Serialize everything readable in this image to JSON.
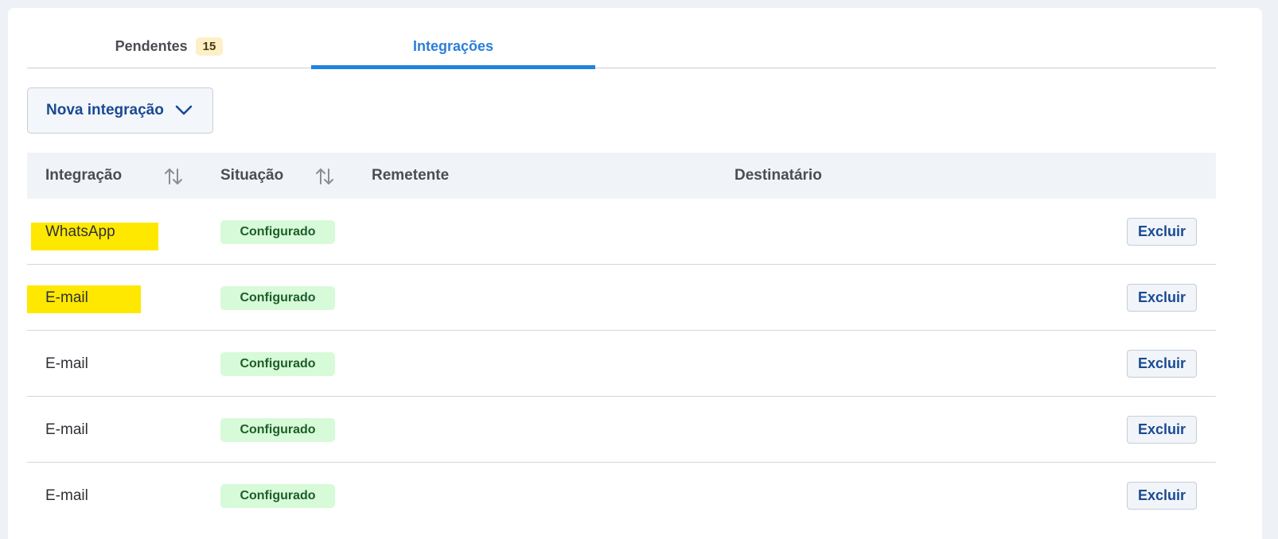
{
  "tabs": [
    {
      "label": "Pendentes",
      "count": "15"
    },
    {
      "label": "Integrações"
    }
  ],
  "new_button": {
    "label": "Nova integração",
    "icon": "chevron-down-icon"
  },
  "table": {
    "headers": {
      "integration": "Integração",
      "status": "Situação",
      "sender": "Remetente",
      "recipient": "Destinatário"
    },
    "rows": [
      {
        "name": "WhatsApp",
        "status": "Configurado",
        "action": "Excluir",
        "highlighted": true
      },
      {
        "name": "E-mail",
        "status": "Configurado",
        "action": "Excluir",
        "highlighted": true
      },
      {
        "name": "E-mail",
        "status": "Configurado",
        "action": "Excluir",
        "highlighted": false
      },
      {
        "name": "E-mail",
        "status": "Configurado",
        "action": "Excluir",
        "highlighted": false
      },
      {
        "name": "E-mail",
        "status": "Configurado",
        "action": "Excluir",
        "highlighted": false
      }
    ]
  },
  "colors": {
    "accent": "#2183e0",
    "highlight": "#ffe800",
    "status_bg": "#d7fad8",
    "badge_bg": "#fdf0c6"
  }
}
